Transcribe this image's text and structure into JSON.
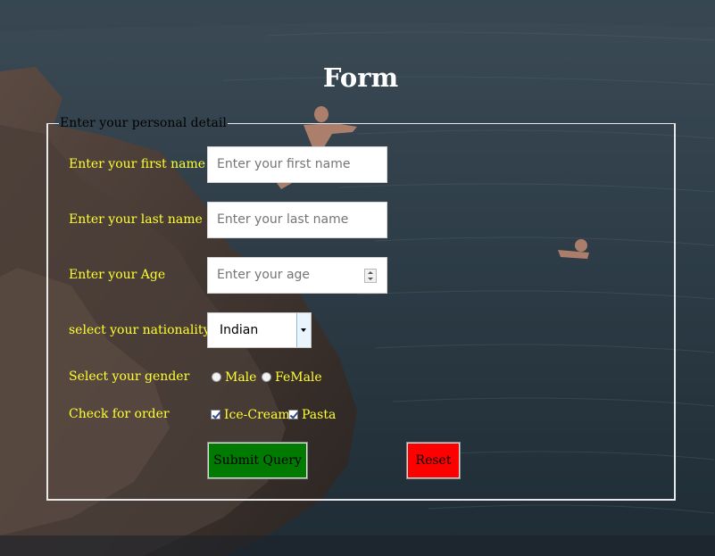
{
  "page": {
    "title": "Form"
  },
  "form": {
    "legend": "Enter your personal detail",
    "first_name": {
      "label": "Enter your first name",
      "placeholder": "Enter your first name"
    },
    "last_name": {
      "label": "Enter your last name",
      "placeholder": "Enter your last name"
    },
    "age": {
      "label": "Enter your Age",
      "placeholder": "Enter your age"
    },
    "nationality": {
      "label": "select your nationality",
      "selected": "Indian"
    },
    "gender": {
      "label": "Select your gender",
      "options": [
        "Male",
        "FeMale"
      ]
    },
    "order": {
      "label": "Check for order",
      "options": [
        "Ice-Cream",
        "Pasta"
      ]
    },
    "buttons": {
      "submit": "Submit Query",
      "reset": "Reset"
    }
  },
  "colors": {
    "label_text": "#ffff33",
    "submit_bg": "#007a00",
    "reset_bg": "#ff0000"
  },
  "icons": {
    "spinner": "number-spinner-icon",
    "dropdown": "dropdown-arrow-icon"
  }
}
